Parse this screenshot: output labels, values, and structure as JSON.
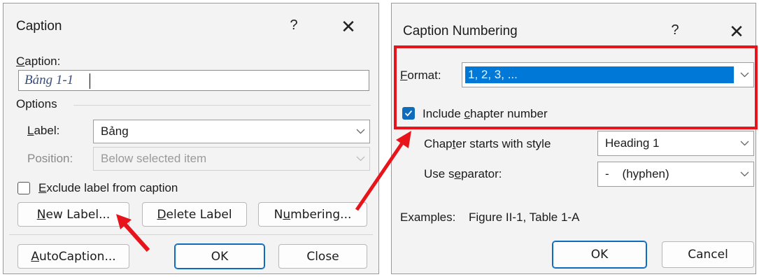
{
  "caption_dialog": {
    "title": "Caption",
    "help_label": "?",
    "close_label": "✕",
    "caption_label": "Caption:",
    "caption_value": "Bảng 1-1",
    "options_label": "Options",
    "label_label": "Label:",
    "label_value": "Bảng",
    "position_label": "Position:",
    "position_value": "Below selected item",
    "exclude_label": "Exclude label from caption",
    "exclude_checked": false,
    "new_label_button": "New Label...",
    "delete_label_button": "Delete Label",
    "numbering_button": "Numbering...",
    "autocaption_button": "AutoCaption...",
    "ok_button": "OK",
    "close_button": "Close"
  },
  "numbering_dialog": {
    "title": "Caption Numbering",
    "help_label": "?",
    "close_label": "✕",
    "format_label": "Format:",
    "format_value": "1, 2, 3, ...",
    "include_chapter_label": "Include chapter number",
    "include_chapter_checked": true,
    "chapter_starts_label": "Chapter starts with style",
    "chapter_starts_value": "Heading 1",
    "separator_label": "Use separator:",
    "separator_value": "-    (hyphen)",
    "examples_label": "Examples:",
    "examples_value": "Figure II-1, Table 1-A",
    "ok_button": "OK",
    "cancel_button": "Cancel"
  },
  "colors": {
    "accent": "#0f6cbd",
    "annotation_red": "#e8141c",
    "selection_blue": "#0078d7"
  },
  "icons": [
    "question-icon",
    "close-icon",
    "chevron-down-icon",
    "checkmark-icon",
    "arrow-icon"
  ]
}
